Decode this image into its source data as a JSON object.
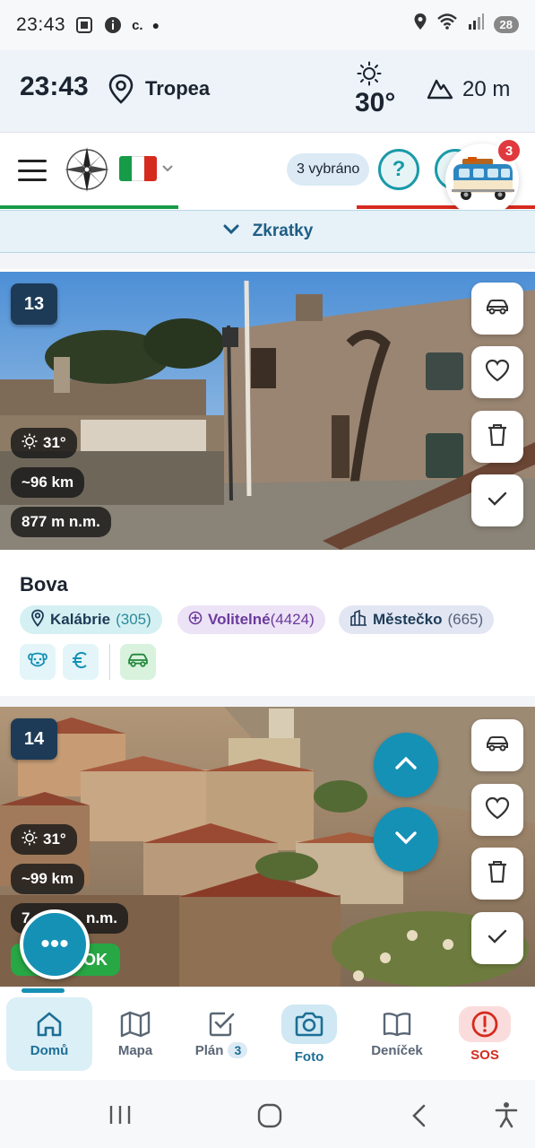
{
  "status_bar": {
    "time": "23:43",
    "notif_text": "c.",
    "battery": "28"
  },
  "info_bar": {
    "time": "23:43",
    "location": "Tropea",
    "temperature": "30°",
    "altitude": "20 m"
  },
  "header": {
    "selected_label": "3 vybráno",
    "help_symbol": "?",
    "van_badge_count": "3",
    "flag_colors": [
      "#169b48",
      "#ffffff",
      "#d52b1e"
    ]
  },
  "shortcuts": {
    "label": "Zkratky"
  },
  "cards": [
    {
      "number": "13",
      "temp": "31°",
      "distance": "~96 km",
      "elevation": "877 m n.m.",
      "title": "Bova",
      "tags": {
        "region": {
          "label": "Kalábrie",
          "count": "(305)"
        },
        "optional": {
          "label": "Volitelné",
          "count": "(4424)"
        },
        "type": {
          "label": "Městečko",
          "count": "(665)"
        }
      }
    },
    {
      "number": "14",
      "temp": "31°",
      "distance": "~99 km",
      "elevation_visible": "7",
      "elevation_tail": "n.m.",
      "ok_label": "OK"
    }
  ],
  "fab": {
    "more_label": "•••"
  },
  "bottom_nav": [
    {
      "label": "Domů",
      "icon": "home-icon",
      "active": true
    },
    {
      "label": "Mapa",
      "icon": "map-icon"
    },
    {
      "label": "Plán",
      "icon": "checklist-icon",
      "count": "3"
    },
    {
      "label": "Foto",
      "icon": "camera-icon"
    },
    {
      "label": "Deníček",
      "icon": "book-icon"
    },
    {
      "label": "SOS",
      "icon": "alert-icon"
    }
  ],
  "colors": {
    "primary": "#1591b6",
    "navy": "#1d3b57",
    "sos": "#d52b1e",
    "ok_green": "#28a745"
  }
}
